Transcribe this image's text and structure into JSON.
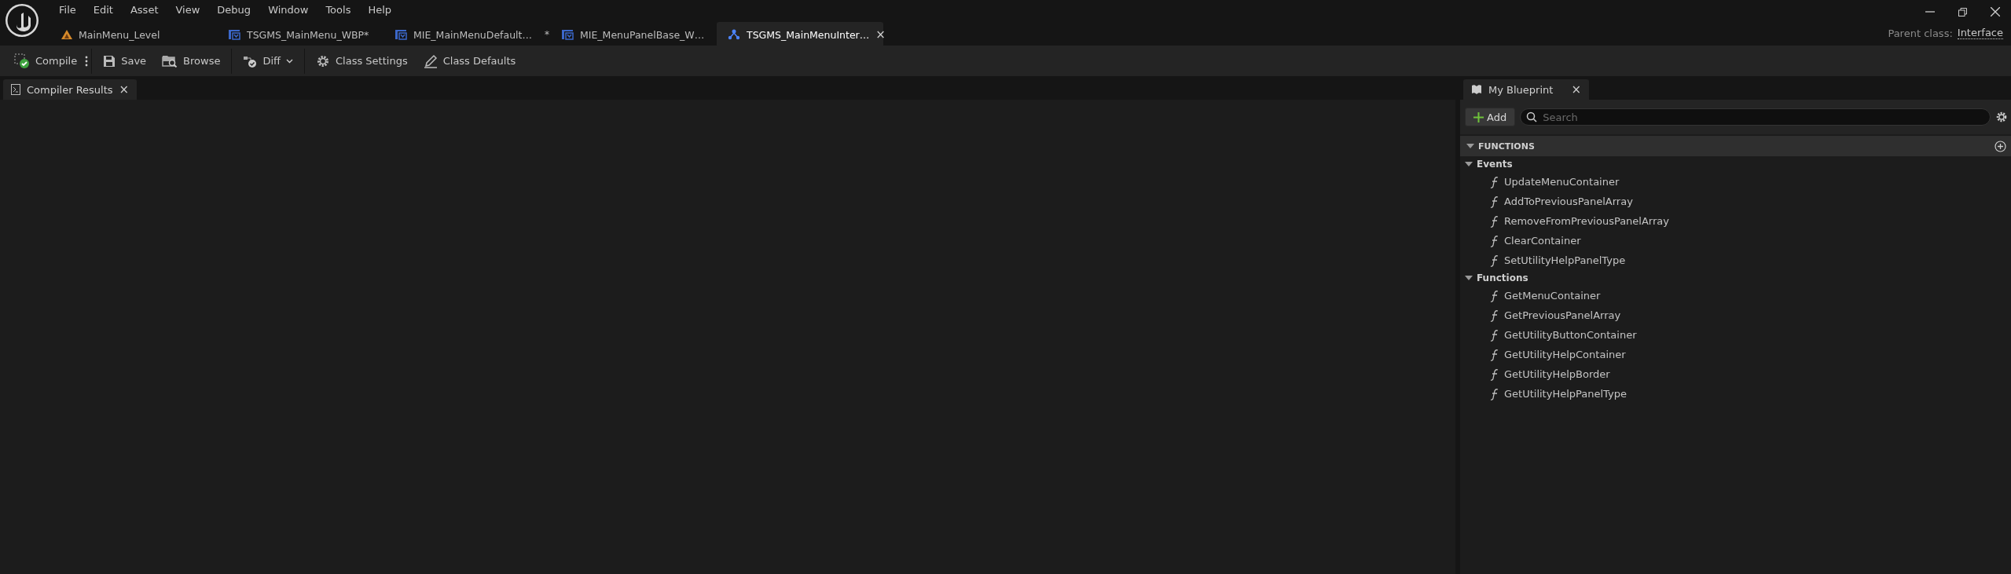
{
  "menu": [
    "File",
    "Edit",
    "Asset",
    "View",
    "Debug",
    "Window",
    "Tools",
    "Help"
  ],
  "tabs": [
    {
      "kind": "level",
      "label": "MainMenu_Level",
      "selected": false
    },
    {
      "kind": "widget",
      "label": "TSGMS_MainMenu_WBP*",
      "selected": false
    },
    {
      "kind": "widget",
      "label": "MIE_MainMenuDefault…",
      "marker": "*",
      "selected": false
    },
    {
      "kind": "widget",
      "label": "MIE_MenuPanelBase_W…",
      "selected": false
    },
    {
      "kind": "interface",
      "label": "TSGMS_MainMenuInter…",
      "close": "×",
      "selected": true
    }
  ],
  "parent_class": {
    "label": "Parent class:",
    "value": "Interface"
  },
  "toolbar": [
    {
      "kind": "compile",
      "label": "Compile"
    },
    {
      "kind": "save",
      "label": "Save"
    },
    {
      "kind": "browse",
      "label": "Browse"
    },
    {
      "kind": "diff",
      "label": "Diff"
    },
    {
      "kind": "settings",
      "label": "Class Settings"
    },
    {
      "kind": "defaults",
      "label": "Class Defaults"
    }
  ],
  "left_panel": {
    "tab": "Compiler Results",
    "close": "×"
  },
  "my_blueprint": {
    "tab": "My Blueprint",
    "close": "×",
    "add": "Add",
    "search": {
      "placeholder": "Search"
    },
    "section": "FUNCTIONS",
    "categories": [
      {
        "name": "Events",
        "expanded": true,
        "children": [
          {
            "name": "UpdateMenuContainer"
          },
          {
            "name": "AddToPreviousPanelArray"
          },
          {
            "name": "RemoveFromPreviousPanelArray"
          },
          {
            "name": "ClearContainer"
          },
          {
            "name": "SetUtilityHelpPanelType"
          }
        ]
      },
      {
        "name": "Functions",
        "expanded": true,
        "children": [
          {
            "name": "GetMenuContainer"
          },
          {
            "name": "GetPreviousPanelArray"
          },
          {
            "name": "GetUtilityButtonContainer"
          },
          {
            "name": "GetUtilityHelpContainer"
          },
          {
            "name": "GetUtilityHelpBorder"
          },
          {
            "name": "GetUtilityHelpPanelType"
          }
        ]
      }
    ]
  }
}
